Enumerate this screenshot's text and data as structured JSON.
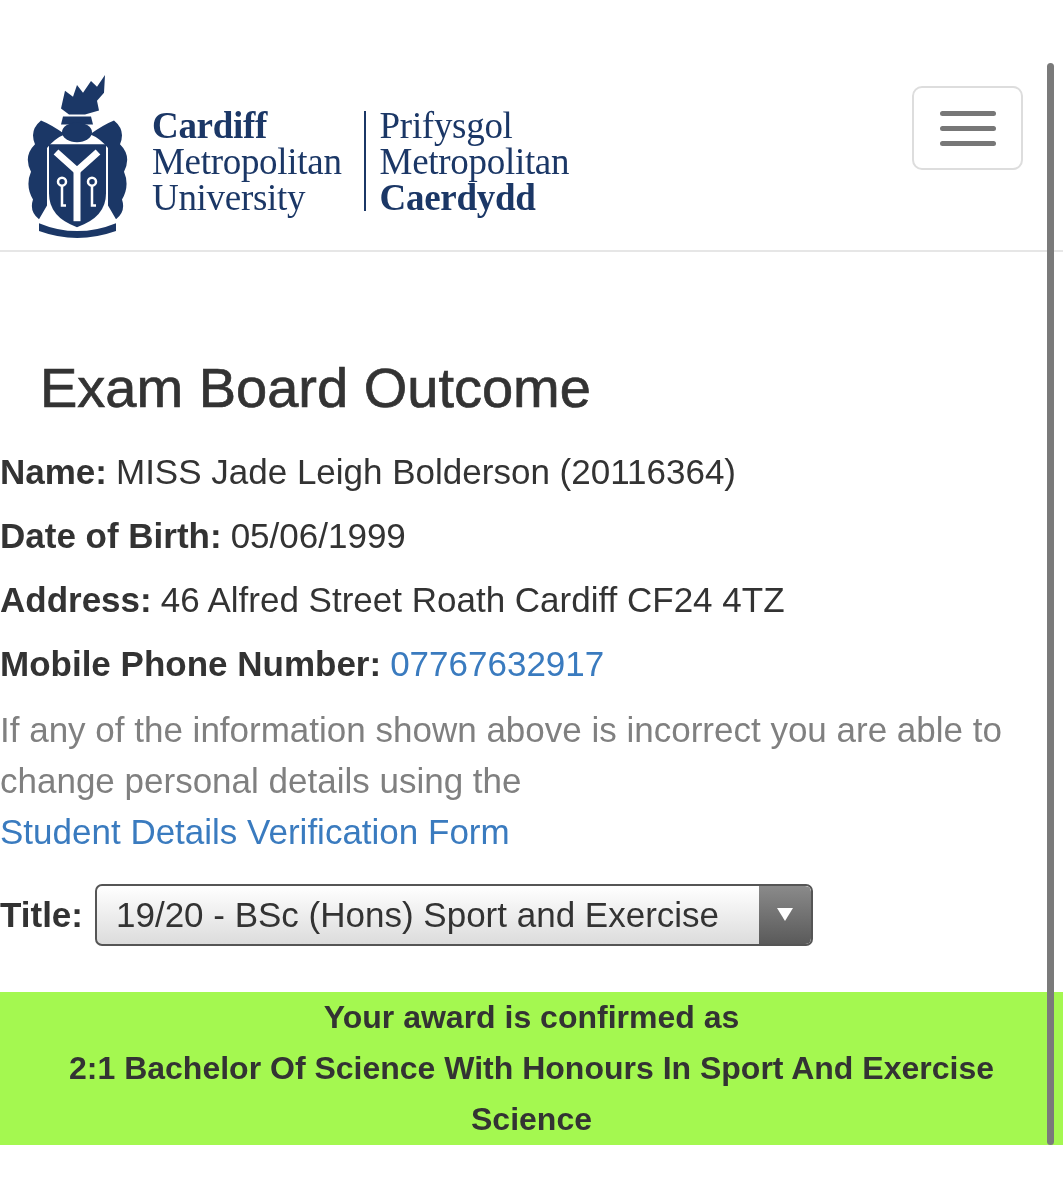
{
  "header": {
    "logo": {
      "english": [
        {
          "text": "Cardiff",
          "bold": true
        },
        {
          "text": "Metropolitan",
          "bold": false
        },
        {
          "text": "University",
          "bold": false
        }
      ],
      "welsh": [
        {
          "text": "Prifysgol",
          "bold": false
        },
        {
          "text": "Metropolitan",
          "bold": false
        },
        {
          "text": "Caerdydd",
          "bold": true
        }
      ]
    }
  },
  "title": "Exam Board Outcome",
  "details": [
    {
      "label": "Name:",
      "value": "MISS Jade Leigh Bolderson (20116364)",
      "kind": "text"
    },
    {
      "label": "Date of Birth:",
      "value": "05/06/1999",
      "kind": "text"
    },
    {
      "label": "Address:",
      "value": "46 Alfred Street Roath Cardiff CF24 4TZ",
      "kind": "text"
    },
    {
      "label": "Mobile Phone Number:",
      "value": "07767632917",
      "kind": "link"
    }
  ],
  "notice": {
    "text": "If any of the information shown above is incorrect you are able to change personal details using the",
    "link": "Student Details Verification Form"
  },
  "course_select": {
    "label": "Title:",
    "value": "19/20 - BSc (Hons) Sport and Exercise"
  },
  "award": {
    "lines": [
      "Your award is confirmed as",
      "2:1 Bachelor Of Science With Honours In Sport And Exercise Science"
    ]
  }
}
